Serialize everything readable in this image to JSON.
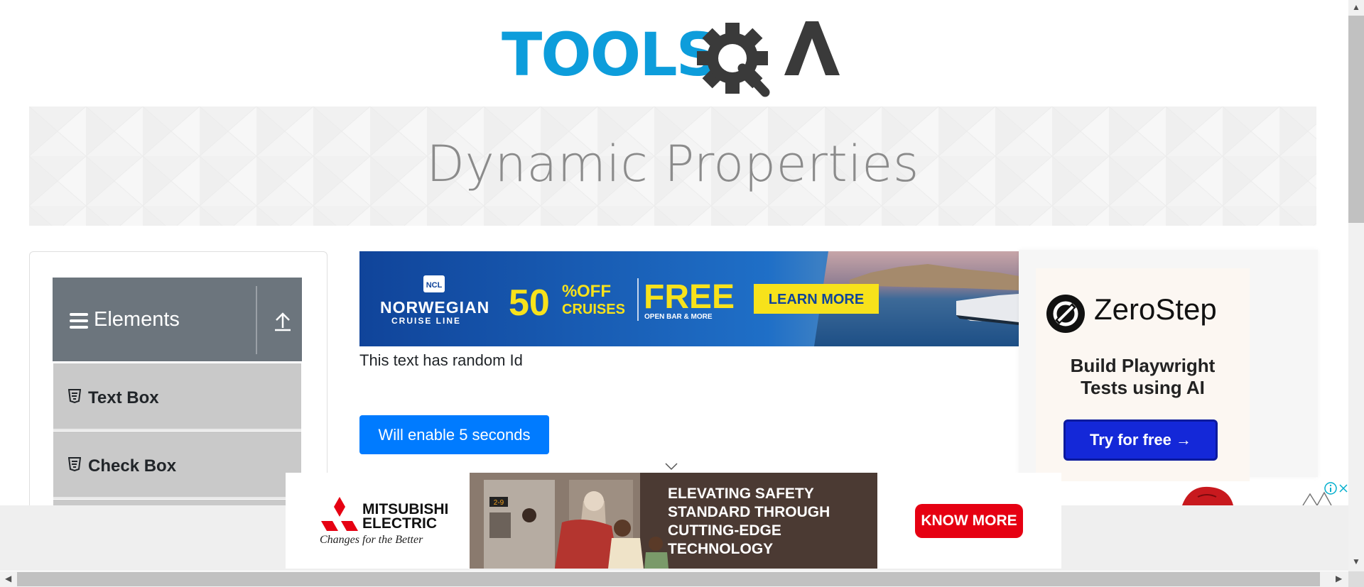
{
  "header": {
    "logo_text_left": "TOOLS",
    "logo_text_right": "A"
  },
  "banner": {
    "title": "Dynamic Properties"
  },
  "sidebar": {
    "group": {
      "label": "Elements",
      "icon": "hamburger-icon",
      "toggle_icon": "collapse-up-icon"
    },
    "items": [
      {
        "label": "Text Box",
        "icon": "html5-icon"
      },
      {
        "label": "Check Box",
        "icon": "html5-icon"
      }
    ]
  },
  "ads": {
    "ncl": {
      "brand_badge": "NCL",
      "brand_line1": "NORWEGIAN",
      "brand_line2": "CRUISE LINE",
      "percent": "50",
      "percent_sign": "%",
      "off": "OFF",
      "cruises": "CRUISES",
      "free": "FREE",
      "free_sub": "OPEN BAR & MORE",
      "cta": "LEARN MORE"
    },
    "zerostep": {
      "brand": "ZeroStep",
      "tagline_line1": "Build Playwright",
      "tagline_line2": "Tests using AI",
      "cta": "Try for free →"
    },
    "mitsubishi": {
      "brand_line1": "MITSUBISHI",
      "brand_line2": "ELECTRIC",
      "slogan": "Changes for the Better",
      "headline_line1": "ELEVATING SAFETY",
      "headline_line2": "STANDARD THROUGH",
      "headline_line3": "CUTTING-EDGE",
      "headline_line4": "TECHNOLOGY",
      "cta": "KNOW MORE",
      "panel": "2-9"
    }
  },
  "main": {
    "random_id_text": "This text has random Id",
    "enable_button_label": "Will enable 5 seconds"
  },
  "colors": {
    "primary_button": "#007bff",
    "nav_header": "#6c757d",
    "nav_item": "#c9c9c9",
    "logo_blue": "#0d9ddb",
    "logo_dark": "#3a3a3a",
    "ad_red": "#e60012",
    "zerostep_blue": "#1428d8"
  }
}
